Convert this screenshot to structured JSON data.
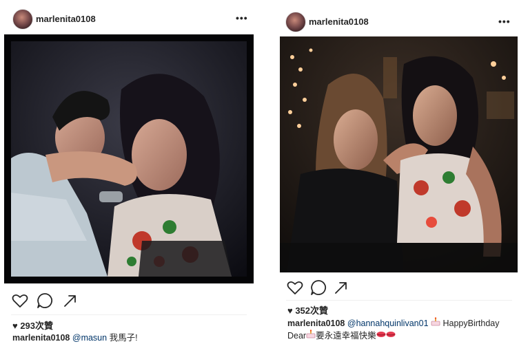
{
  "left_post": {
    "username": "marlenita0108",
    "more_label": "•••",
    "likes": "♥ 293次贊",
    "caption": {
      "username": "marlenita0108",
      "mention": "@masun",
      "text": " 我馬子!"
    }
  },
  "right_post": {
    "username": "marlenita0108",
    "more_label": "•••",
    "likes": "♥ 352次贊",
    "caption": {
      "username": "marlenita0108",
      "mention": "@hannahquinlivan01",
      "text_line1": " HappyBirthday",
      "text_line2_a": "Dear",
      "text_line2_b": "要永遠幸福快樂"
    }
  },
  "icons": [
    "heart-icon",
    "comment-icon",
    "share-icon",
    "cake-icon",
    "kiss-icon"
  ]
}
